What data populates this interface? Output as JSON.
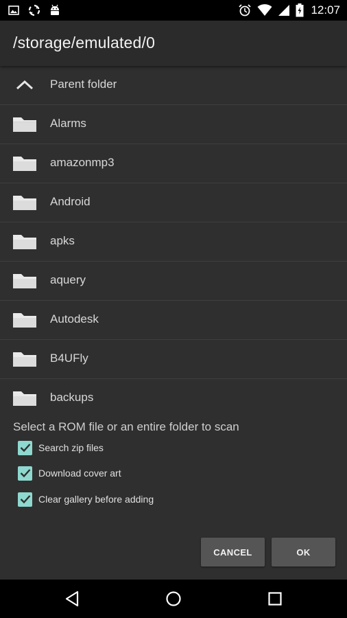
{
  "status_bar": {
    "time": "12:07",
    "left_icons": [
      "image-icon",
      "sync-icon",
      "android-icon"
    ],
    "right_icons": [
      "alarm-icon",
      "wifi-icon",
      "signal-icon",
      "battery-charging-icon"
    ]
  },
  "header": {
    "title": "/storage/emulated/0"
  },
  "list": {
    "parent_label": "Parent folder",
    "folders": [
      {
        "label": "Alarms"
      },
      {
        "label": "amazonmp3"
      },
      {
        "label": "Android"
      },
      {
        "label": "apks"
      },
      {
        "label": "aquery"
      },
      {
        "label": "Autodesk"
      },
      {
        "label": "B4UFly"
      },
      {
        "label": "backups"
      }
    ]
  },
  "hint": "Select a ROM file or an entire folder to scan",
  "options": [
    {
      "label": "Search zip files",
      "checked": true
    },
    {
      "label": "Download cover art",
      "checked": true
    },
    {
      "label": "Clear gallery before adding",
      "checked": true
    }
  ],
  "buttons": {
    "cancel": "CANCEL",
    "ok": "OK"
  },
  "colors": {
    "checkbox": "#8ed8cf",
    "background": "#2f2f2f",
    "button": "#555555"
  }
}
